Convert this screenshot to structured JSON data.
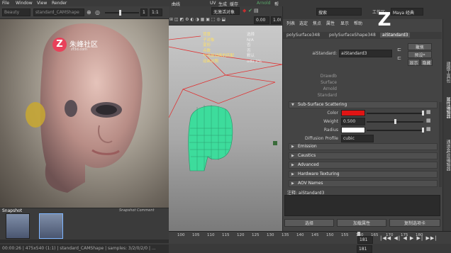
{
  "main_menu": {
    "file": "File",
    "window": "Window",
    "view": "View",
    "render": "Render"
  },
  "render_view": {
    "toolbar_mode": "Beauty",
    "camera": "standard_CAMShape",
    "frame_value": "1",
    "frame_ratio": "1:1",
    "watermark_text": "朱峰社区",
    "watermark_site": "zf3d.com",
    "snapshot_label": "Snapshot",
    "snapshot_comment": "Snapshot Comment",
    "status_text": "00:00:26 | 475x540 (1:1) | standard_CAMShape | samples: 3/2/0/2/0 | ..."
  },
  "viewport": {
    "menu": [
      "视图",
      "着色",
      "照明",
      "显示",
      "渲染器",
      "面板"
    ],
    "extra_menu": [
      "曲线",
      "UV",
      "生成",
      "缓存",
      "Arnold",
      "帮助"
    ],
    "arnold_tab": "Arnold",
    "live_surface": "无激活对象",
    "exposure": "0.00",
    "gamma": "1.00",
    "hud_labels": [
      "对象:",
      "子对象:",
      "变形:",
      "接触:",
      "点:",
      "面:"
    ],
    "hud_labels_display": [
      "背景",
      "子对象",
      "变形",
      "点数",
      "与当前动画的匹配",
      "动画对照"
    ],
    "hud_values": [
      "选择",
      "N/A",
      "否",
      "否",
      "0/0",
      "0/0"
    ],
    "hud_values_display": [
      "选择",
      "N/A",
      "否",
      "否",
      "默认",
      "odu 2%"
    ]
  },
  "timeline": {
    "ticks": [
      "100",
      "105",
      "110",
      "115",
      "120",
      "125",
      "130",
      "135",
      "140",
      "145",
      "150",
      "155",
      "160",
      "165",
      "170",
      "175",
      "180"
    ],
    "current_frame": "181",
    "end_frame": "181"
  },
  "attribute_editor": {
    "workspace_label": "工作区:",
    "workspace_value": "Maya 经典",
    "search_placeholder": "搜索",
    "menu": [
      "列表",
      "选定",
      "焦点",
      "属性",
      "显示",
      "帮助"
    ],
    "tabs": [
      "polySurface348",
      "polySurfaceShape348",
      "aiStandard3"
    ],
    "active_tab_index": 2,
    "shader_label": "aiStandard:",
    "shader_name": "aiStandard3",
    "focus_button": "聚焦",
    "presets_button": "预设*",
    "show_button": "显示",
    "hide_button": "隐藏",
    "dim_labels": [
      "Drawdb",
      "Surface",
      "Arnold",
      "Standard"
    ],
    "sections": {
      "sss": "Sub-Surface Scattering",
      "emission": "Emission",
      "caustics": "Caustics",
      "advanced": "Advanced",
      "hw": "Hardware Texturing",
      "aov": "AOV Names"
    },
    "sss_fields": {
      "color_label": "Color",
      "weight_label": "Weight",
      "weight_value": "0.500",
      "weight_fraction": 0.5,
      "radius_label": "Radius",
      "profile_label": "Diffusion Profile",
      "profile_value": "cubic"
    },
    "notes_label": "注释: aiStandard3",
    "buttons": {
      "select": "选择",
      "load": "加载属性",
      "copy": "复制选项卡"
    },
    "colors": {
      "sss_color": "#e01414",
      "radius_color": "#ffffff",
      "accent": "#5aa86a"
    }
  },
  "side_tabs": [
    "建模工具包",
    "属性编辑器",
    "通道盒/层编辑器"
  ],
  "icons": [
    "zoom-icon",
    "camera-icon",
    "gear-icon",
    "snapshot-icon",
    "arnold-logo-icon",
    "play-icon",
    "prev-icon",
    "next-icon",
    "end-icon",
    "start-icon",
    "key-icon"
  ]
}
